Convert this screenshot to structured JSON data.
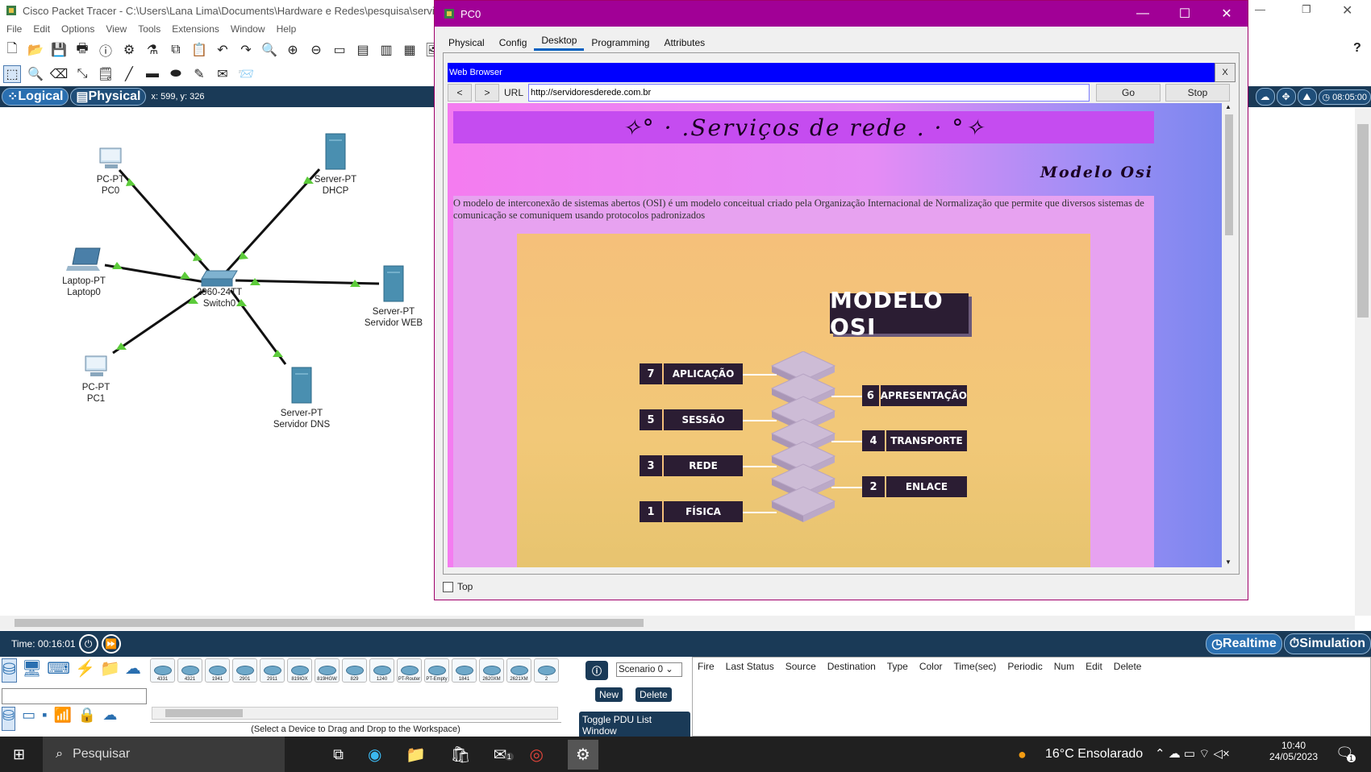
{
  "app": {
    "title": "Cisco Packet Tracer - C:\\Users\\Lana Lima\\Documents\\Hardware e Redes\\pesquisa\\servid",
    "menu": [
      "File",
      "Edit",
      "Options",
      "View",
      "Tools",
      "Extensions",
      "Window",
      "Help"
    ],
    "logical_label": "Logical",
    "physical_label": "Physical",
    "coords": "x: 599, y: 326",
    "clock": "08:05:00",
    "help_icon": "?"
  },
  "devices": {
    "pc0": {
      "type": "PC-PT",
      "name": "PC0"
    },
    "dhcp": {
      "type": "Server-PT",
      "name": "DHCP"
    },
    "laptop": {
      "type": "Laptop-PT",
      "name": "Laptop0"
    },
    "switch": {
      "type": "2960-24TT",
      "name": "Switch0"
    },
    "web": {
      "type": "Server-PT",
      "name": "Servidor WEB"
    },
    "pc1": {
      "type": "PC-PT",
      "name": "PC1"
    },
    "dns": {
      "type": "Server-PT",
      "name": "Servidor DNS"
    }
  },
  "pc0_window": {
    "title": "PC0",
    "tabs": [
      "Physical",
      "Config",
      "Desktop",
      "Programming",
      "Attributes"
    ],
    "active_tab": "Desktop",
    "browser": {
      "title": "Web Browser",
      "close": "X",
      "back": "<",
      "forward": ">",
      "url_label": "URL",
      "url": "http://servidoresderede.com.br",
      "go": "Go",
      "stop": "Stop"
    },
    "webpage": {
      "heading": "✧° · .Serviços de rede . · °✧",
      "subheading": "Modelo Osi",
      "paragraph": "O modelo de interconexão de sistemas abertos (OSI) é um modelo conceitual criado pela Organização Internacional de Normalização que permite que diversos sistemas de comunicação se comuniquem usando protocolos padronizados",
      "osi_title": "MODELO OSI",
      "layers_left": [
        {
          "num": "7",
          "name": "APLICAÇÃO"
        },
        {
          "num": "5",
          "name": "SESSÃO"
        },
        {
          "num": "3",
          "name": "REDE"
        },
        {
          "num": "1",
          "name": "FÍSICA"
        }
      ],
      "layers_right": [
        {
          "num": "6",
          "name": "APRESENTAÇÃO"
        },
        {
          "num": "4",
          "name": "TRANSPORTE"
        },
        {
          "num": "2",
          "name": "ENLACE"
        }
      ]
    },
    "top_checkbox": "Top"
  },
  "sim": {
    "time": "Time: 00:16:01",
    "realtime": "Realtime",
    "simulation": "Simulation",
    "scenario": "Scenario 0",
    "new": "New",
    "delete": "Delete",
    "toggle": "Toggle PDU List Window",
    "pdu_headers": [
      "Fire",
      "Last Status",
      "Source",
      "Destination",
      "Type",
      "Color",
      "Time(sec)",
      "Periodic",
      "Num",
      "Edit",
      "Delete"
    ],
    "device_models": [
      "4331",
      "4321",
      "1941",
      "2901",
      "2911",
      "819IOX",
      "819HGW",
      "829",
      "1240",
      "PT-Router",
      "PT-Empty",
      "1841",
      "2620XM",
      "2621XM",
      "2"
    ],
    "device_hint": "(Select a Device to Drag and Drop to the Workspace)"
  },
  "taskbar": {
    "search": "Pesquisar",
    "weather": "16°C  Ensolarado",
    "time": "10:40",
    "date": "24/05/2023",
    "mail_badge": "1",
    "notif_badge": "1"
  }
}
